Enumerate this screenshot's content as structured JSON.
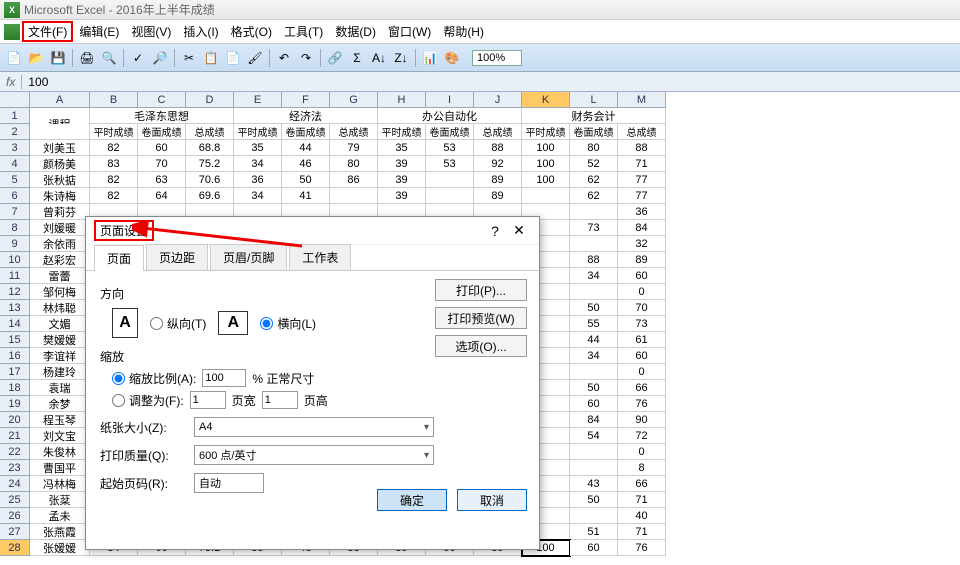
{
  "title": {
    "app": "Microsoft Excel",
    "doc": "2016年上半年成绩"
  },
  "menu": {
    "file": "文件(F)",
    "edit": "编辑(E)",
    "view": "视图(V)",
    "insert": "插入(I)",
    "format": "格式(O)",
    "tools": "工具(T)",
    "data": "数据(D)",
    "window": "窗口(W)",
    "help": "帮助(H)"
  },
  "zoom": "100%",
  "formula": {
    "fx": "fx",
    "value": "100"
  },
  "colLetters": [
    "A",
    "B",
    "C",
    "D",
    "E",
    "F",
    "G",
    "H",
    "I",
    "J",
    "K",
    "L",
    "M"
  ],
  "headerRow1": {
    "A": "课程",
    "groups": [
      "毛泽东思想",
      "",
      "经济法",
      "",
      "办公自动化",
      "",
      "财务会计",
      ""
    ]
  },
  "headerRow2": [
    "平时成绩",
    "卷面成绩",
    "总成绩",
    "平时成绩",
    "卷面成绩",
    "总成绩",
    "平时成绩",
    "卷面成绩",
    "总成绩",
    "平时成绩",
    "卷面成绩",
    "总成绩"
  ],
  "rows": [
    {
      "n": "3",
      "name": "刘美玉",
      "v": [
        "82",
        "60",
        "68.8",
        "35",
        "44",
        "79",
        "35",
        "53",
        "88",
        "100",
        "80",
        "88"
      ]
    },
    {
      "n": "4",
      "name": "颜杨美",
      "v": [
        "83",
        "70",
        "75.2",
        "34",
        "46",
        "80",
        "39",
        "53",
        "92",
        "100",
        "52",
        "71"
      ]
    },
    {
      "n": "5",
      "name": "张秋掂",
      "v": [
        "82",
        "63",
        "70.6",
        "36",
        "50",
        "86",
        "39",
        "",
        "89",
        "100",
        "62",
        "77"
      ]
    },
    {
      "n": "6",
      "name": "朱诗梅",
      "v": [
        "82",
        "64",
        "69.6",
        "34",
        "41",
        "",
        "39",
        "",
        "89",
        "",
        "62",
        "77"
      ]
    },
    {
      "n": "7",
      "name": "曾莉芬",
      "v": [
        "",
        "",
        "",
        "",
        "",
        "",
        "",
        "",
        "",
        "",
        "",
        "36"
      ]
    },
    {
      "n": "8",
      "name": "刘媛暖",
      "v": [
        "",
        "",
        "",
        "",
        "",
        "",
        "",
        "",
        "",
        "",
        "73",
        "84"
      ]
    },
    {
      "n": "9",
      "name": "余依雨",
      "v": [
        "",
        "",
        "",
        "",
        "",
        "",
        "",
        "",
        "",
        "",
        "",
        "32"
      ]
    },
    {
      "n": "10",
      "name": "赵彩宏",
      "v": [
        "",
        "",
        "",
        "",
        "",
        "",
        "",
        "",
        "",
        "",
        "88",
        "89"
      ]
    },
    {
      "n": "11",
      "name": "雷蕾",
      "v": [
        "",
        "",
        "",
        "",
        "",
        "",
        "",
        "",
        "",
        "",
        "34",
        "60"
      ]
    },
    {
      "n": "12",
      "name": "邹何梅",
      "v": [
        "",
        "",
        "",
        "",
        "",
        "",
        "",
        "",
        "",
        "",
        "",
        "0"
      ]
    },
    {
      "n": "13",
      "name": "林炜聪",
      "v": [
        "",
        "",
        "",
        "",
        "",
        "",
        "",
        "",
        "",
        "",
        "50",
        "70"
      ]
    },
    {
      "n": "14",
      "name": "文媚",
      "v": [
        "",
        "",
        "",
        "",
        "",
        "",
        "",
        "",
        "",
        "",
        "55",
        "73"
      ]
    },
    {
      "n": "15",
      "name": "樊嫒嫒",
      "v": [
        "",
        "",
        "",
        "",
        "",
        "",
        "",
        "",
        "",
        "",
        "44",
        "61"
      ]
    },
    {
      "n": "16",
      "name": "李谊祥",
      "v": [
        "",
        "",
        "",
        "",
        "",
        "",
        "",
        "",
        "",
        "",
        "34",
        "60"
      ]
    },
    {
      "n": "17",
      "name": "杨建玲",
      "v": [
        "",
        "",
        "",
        "",
        "",
        "",
        "",
        "",
        "",
        "",
        "",
        "0"
      ]
    },
    {
      "n": "18",
      "name": "袁瑞",
      "v": [
        "",
        "",
        "",
        "",
        "",
        "",
        "",
        "",
        "",
        "",
        "50",
        "66"
      ]
    },
    {
      "n": "19",
      "name": "余梦",
      "v": [
        "",
        "",
        "",
        "",
        "",
        "",
        "",
        "",
        "",
        "",
        "60",
        "76"
      ]
    },
    {
      "n": "20",
      "name": "程玉琴",
      "v": [
        "",
        "",
        "",
        "",
        "",
        "",
        "",
        "",
        "",
        "",
        "84",
        "90"
      ]
    },
    {
      "n": "21",
      "name": "刘文宝",
      "v": [
        "",
        "",
        "",
        "",
        "",
        "",
        "",
        "",
        "",
        "",
        "54",
        "72"
      ]
    },
    {
      "n": "22",
      "name": "朱俊林",
      "v": [
        "",
        "",
        "",
        "",
        "",
        "",
        "",
        "",
        "",
        "",
        "",
        "0"
      ]
    },
    {
      "n": "23",
      "name": "曹国平",
      "v": [
        "",
        "",
        "",
        "",
        "",
        "",
        "",
        "",
        "",
        "",
        "",
        "8"
      ]
    },
    {
      "n": "24",
      "name": "冯林梅",
      "v": [
        "",
        "",
        "",
        "",
        "",
        "",
        "",
        "",
        "",
        "",
        "43",
        "66"
      ]
    },
    {
      "n": "25",
      "name": "张棻",
      "v": [
        "",
        "",
        "",
        "",
        "",
        "",
        "",
        "",
        "",
        "",
        "50",
        "71"
      ]
    },
    {
      "n": "26",
      "name": "孟未",
      "v": [
        "",
        "",
        "",
        "",
        "",
        "",
        "",
        "",
        "",
        "",
        "",
        "40"
      ]
    },
    {
      "n": "27",
      "name": "张燕霞",
      "v": [
        "",
        "",
        "",
        "",
        "",
        "",
        "",
        "",
        "",
        "",
        "51",
        "71"
      ]
    },
    {
      "n": "28",
      "name": "张嫒嫒",
      "v": [
        "84",
        "66",
        "73.2",
        "35",
        "48",
        "83",
        "39",
        "50",
        "89",
        "100",
        "60",
        "76"
      ]
    }
  ],
  "dialog": {
    "title": "页面设置",
    "tabs": {
      "page": "页面",
      "margins": "页边距",
      "headerfooter": "页眉/页脚",
      "sheet": "工作表"
    },
    "orientation": {
      "label": "方向",
      "portrait": "纵向(T)",
      "landscape": "横向(L)"
    },
    "zoom": {
      "label": "缩放",
      "scale": "缩放比例(A):",
      "scaleVal": "100",
      "scaleSuffix": "% 正常尺寸",
      "fit": "调整为(F):",
      "fitW": "1",
      "fitWLabel": "页宽",
      "fitH": "1",
      "fitHLabel": "页高"
    },
    "paper": {
      "label": "纸张大小(Z):",
      "value": "A4"
    },
    "quality": {
      "label": "打印质量(Q):",
      "value": "600 点/英寸"
    },
    "firstPage": {
      "label": "起始页码(R):",
      "value": "自动"
    },
    "buttons": {
      "print": "打印(P)...",
      "preview": "打印预览(W)",
      "options": "选项(O)...",
      "ok": "确定",
      "cancel": "取消"
    }
  }
}
